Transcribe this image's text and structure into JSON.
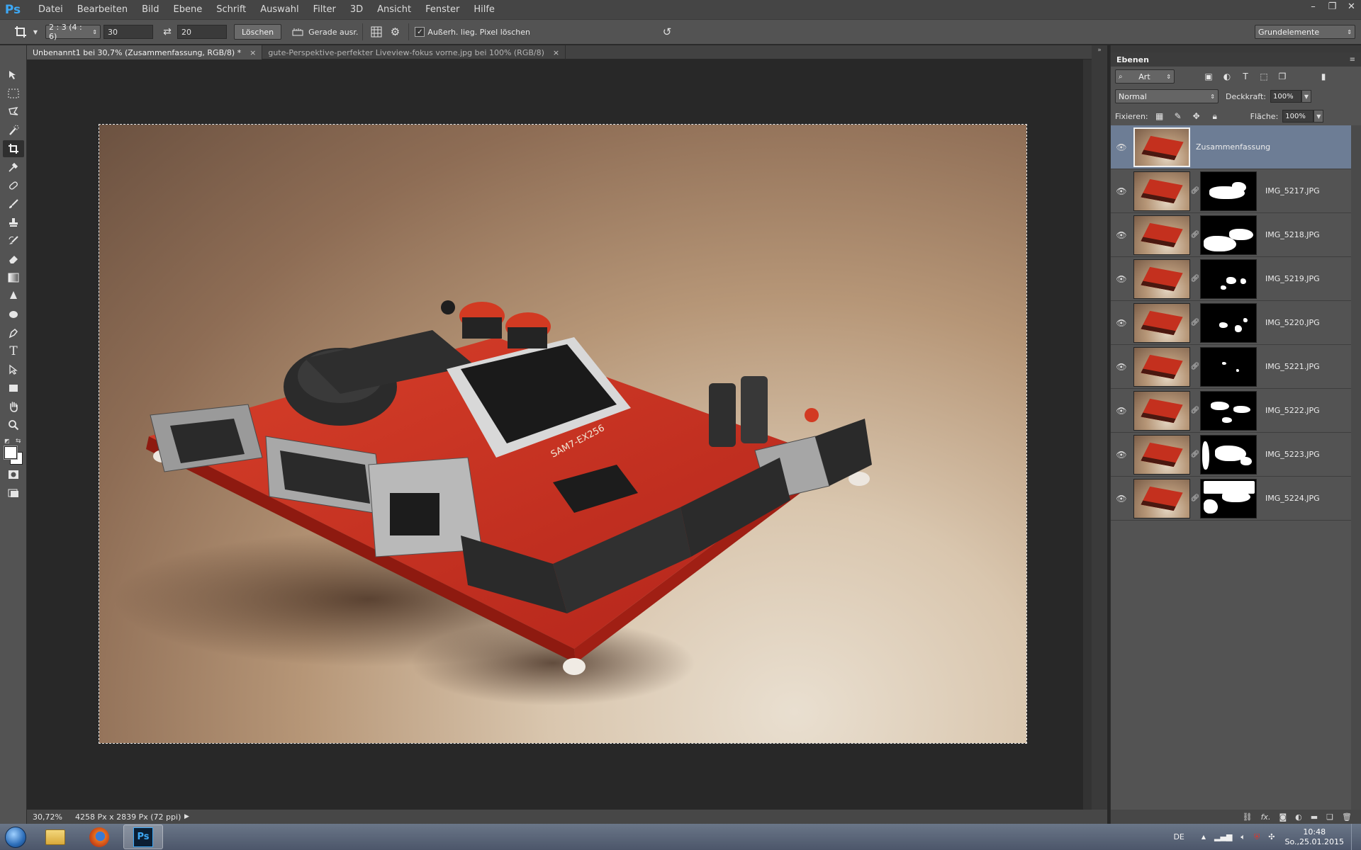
{
  "app": {
    "logo": "Ps"
  },
  "menu": [
    "Datei",
    "Bearbeiten",
    "Bild",
    "Ebene",
    "Schrift",
    "Auswahl",
    "Filter",
    "3D",
    "Ansicht",
    "Fenster",
    "Hilfe"
  ],
  "window_controls": {
    "minimize": "–",
    "restore": "❐",
    "close": "✕"
  },
  "options": {
    "ratio": "2 : 3 (4 : 6)",
    "width_value": "30",
    "height_value": "20",
    "clear_label": "Löschen",
    "straighten_label": "Gerade ausr.",
    "delete_pixels_label": "Außerh. lieg. Pixel löschen",
    "delete_pixels_checked": true,
    "workspace": "Grundelemente"
  },
  "tabs": [
    {
      "title": "Unbenannt1 bei 30,7% (Zusammenfassung, RGB/8) *",
      "close": "×"
    },
    {
      "title": "gute-Perspektive-perfekter Liveview-fokus vorne.jpg bei 100% (RGB/8)",
      "close": "×"
    }
  ],
  "status": {
    "zoom": "30,72%",
    "doc_info": "4258 Px x 2839 Px (72 ppi)"
  },
  "layers_panel": {
    "tab": "Ebenen",
    "filter_kind": "Art",
    "blend_mode": "Normal",
    "opacity_label": "Deckkraft:",
    "opacity": "100%",
    "lock_label": "Fixieren:",
    "fill_label": "Fläche:",
    "fill": "100%",
    "layers": [
      {
        "name": "Zusammenfassung",
        "selected": true,
        "has_mask": false
      },
      {
        "name": "IMG_5217.JPG",
        "has_mask": true
      },
      {
        "name": "IMG_5218.JPG",
        "has_mask": true
      },
      {
        "name": "IMG_5219.JPG",
        "has_mask": true
      },
      {
        "name": "IMG_5220.JPG",
        "has_mask": true
      },
      {
        "name": "IMG_5221.JPG",
        "has_mask": true
      },
      {
        "name": "IMG_5222.JPG",
        "has_mask": true
      },
      {
        "name": "IMG_5223.JPG",
        "has_mask": true
      },
      {
        "name": "IMG_5224.JPG",
        "has_mask": true
      }
    ]
  },
  "taskbar": {
    "apps": [
      "explorer-icon",
      "firefox-icon",
      "photoshop-icon"
    ],
    "ps_label": "Ps",
    "language": "DE",
    "time": "10:48",
    "date": "So.,25.01.2015"
  },
  "colors": {
    "selection": "#6d7d95",
    "panel": "#535353",
    "canvas_bg": "#282828",
    "board_red": "#c4301e"
  }
}
